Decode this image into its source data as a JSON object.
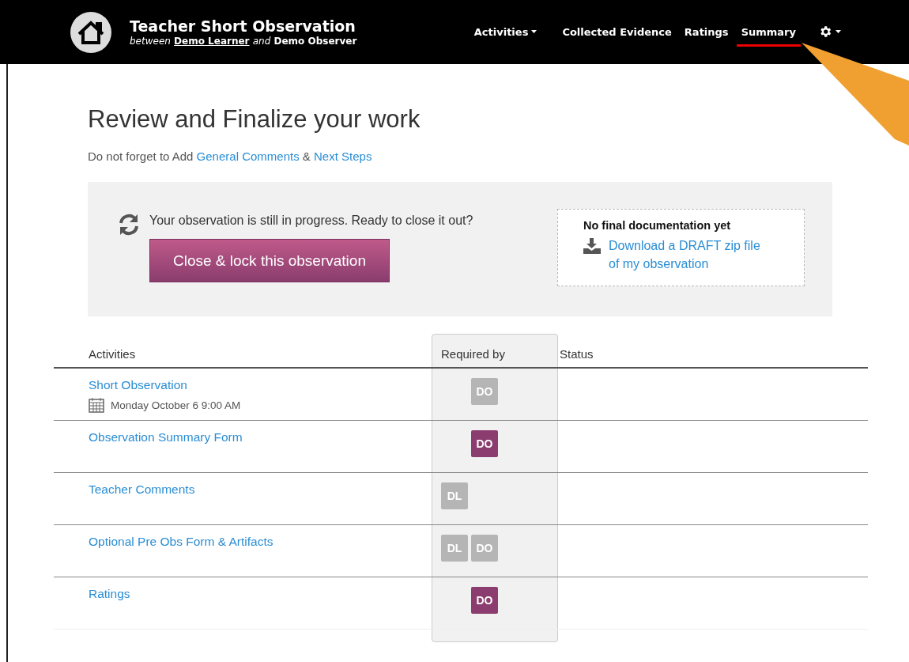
{
  "header": {
    "title": "Teacher Short Observation",
    "subtitle_prefix": "between",
    "learner": "Demo Learner",
    "subtitle_join": "and",
    "observer": "Demo Observer"
  },
  "nav": [
    {
      "label": "Activities",
      "kind": "dropdown",
      "selected": false
    },
    {
      "label": "Collected Evidence",
      "kind": "link",
      "selected": false
    },
    {
      "label": "Ratings",
      "kind": "link",
      "selected": false
    },
    {
      "label": "Summary",
      "kind": "link",
      "selected": true
    },
    {
      "kind": "settings",
      "selected": false
    }
  ],
  "heading": "Review and Finalize your work",
  "reminder": {
    "text": "Do not forget to Add",
    "first_link": "General Comments",
    "joiner": "&",
    "second_link": "Next Steps"
  },
  "status_panel": {
    "message": "Your observation is still in progress. Ready to close it out?",
    "button": "Close & lock this observation",
    "doc_title": "No final documentation yet",
    "download_link": "Download a DRAFT zip file of my observation"
  },
  "table": {
    "columns": [
      "Activities",
      "Required by",
      "Status"
    ],
    "rows": [
      {
        "activity": "Short Observation",
        "date": "Monday October 6 9:00 AM",
        "badges": [
          {
            "label": "DO",
            "kind": "observer",
            "color": "#b5b5b5"
          }
        ]
      },
      {
        "activity": "Observation Summary Form",
        "badges": [
          {
            "label": "DO",
            "kind": "observer",
            "color": "#8a3d6e"
          }
        ]
      },
      {
        "activity": "Teacher Comments",
        "badges": [
          {
            "label": "DL",
            "kind": "learner",
            "color": "#b5b5b5"
          }
        ]
      },
      {
        "activity": "Optional Pre Obs Form & Artifacts",
        "badges": [
          {
            "label": "DL",
            "kind": "learner",
            "color": "#b5b5b5"
          },
          {
            "label": "DO",
            "kind": "observer",
            "color": "#b5b5b5"
          }
        ]
      },
      {
        "activity": "Ratings",
        "badges": [
          {
            "label": "DO",
            "kind": "observer",
            "color": "#8a3d6e"
          }
        ]
      }
    ]
  }
}
